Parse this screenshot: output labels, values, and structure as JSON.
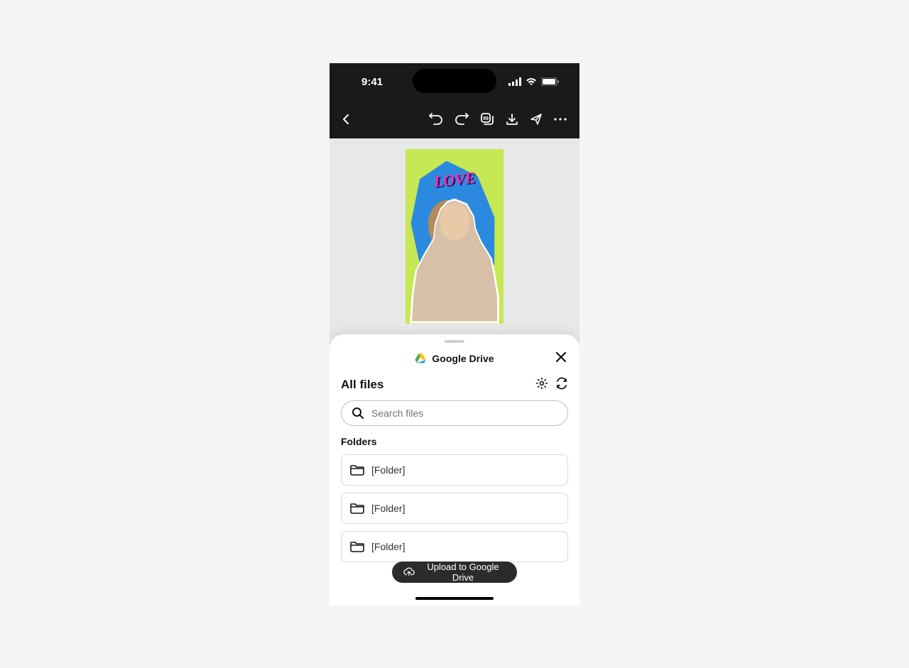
{
  "status": {
    "time": "9:41"
  },
  "artwork": {
    "love_text": "LOVE"
  },
  "sheet": {
    "title": "Google Drive",
    "all_files": "All files",
    "search_placeholder": "Search files",
    "folders_label": "Folders",
    "folders": [
      {
        "name": "[Folder]"
      },
      {
        "name": "[Folder]"
      },
      {
        "name": "[Folder]"
      }
    ],
    "upload_label": "Upload to Google Drive"
  }
}
